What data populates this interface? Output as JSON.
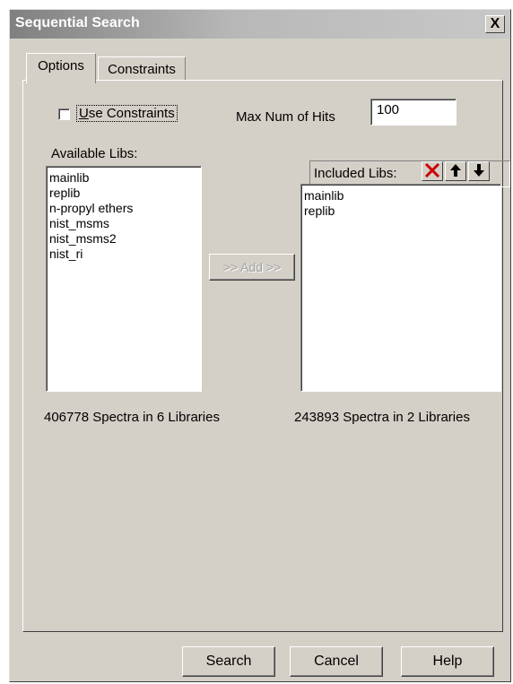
{
  "window": {
    "title": "Sequential Search",
    "close_label": "X"
  },
  "tabs": [
    {
      "label": "Options",
      "active": true
    },
    {
      "label": "Constraints",
      "active": false
    }
  ],
  "options": {
    "use_constraints_accel": "U",
    "use_constraints_rest": "se Constraints",
    "use_constraints_checked": false,
    "max_hits_label": "Max Num of Hits",
    "max_hits_value": "100",
    "available_label": "Available Libs:",
    "available_libs": [
      "mainlib",
      "replib",
      "n-propyl ethers",
      "nist_msms",
      "nist_msms2",
      "nist_ri"
    ],
    "add_button": ">> Add >>",
    "included_label": "Included Libs:",
    "included_libs": [
      "mainlib",
      "replib"
    ],
    "available_summary": "406778 Spectra in 6 Libraries",
    "included_summary": "243893 Spectra in 2 Libraries"
  },
  "icons": {
    "remove": "delete-x-icon",
    "move_up": "arrow-up-icon",
    "move_down": "arrow-down-icon",
    "remove_color": "#cc0000"
  },
  "buttons": {
    "search": "Search",
    "cancel": "Cancel",
    "help": "Help"
  }
}
